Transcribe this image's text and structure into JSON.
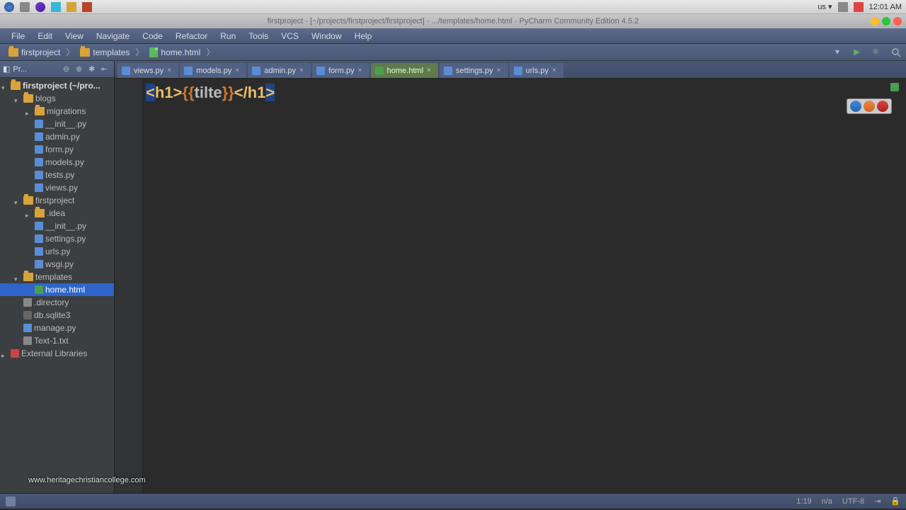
{
  "desktop": {
    "clock": "12:01 AM",
    "indicator": "us ▾"
  },
  "window": {
    "title": "firstproject - [~/projects/firstproject/firstproject] - .../templates/home.html - PyCharm Community Edition 4.5.2"
  },
  "menu": [
    "File",
    "Edit",
    "View",
    "Navigate",
    "Code",
    "Refactor",
    "Run",
    "Tools",
    "VCS",
    "Window",
    "Help"
  ],
  "breadcrumb": [
    {
      "icon": "folder",
      "label": "firstproject"
    },
    {
      "icon": "folder",
      "label": "templates"
    },
    {
      "icon": "html",
      "label": "home.html"
    }
  ],
  "project_panel": {
    "title": "Pr..."
  },
  "tree": {
    "root": {
      "label": "firstproject (~/pro...",
      "icon": "folder"
    },
    "items": [
      {
        "depth": 1,
        "arrow": "down",
        "icon": "folder",
        "label": "blogs"
      },
      {
        "depth": 2,
        "arrow": "right",
        "icon": "folder",
        "label": "migrations"
      },
      {
        "depth": 2,
        "arrow": "none",
        "icon": "py",
        "label": "__init__.py"
      },
      {
        "depth": 2,
        "arrow": "none",
        "icon": "py",
        "label": "admin.py"
      },
      {
        "depth": 2,
        "arrow": "none",
        "icon": "py",
        "label": "form.py"
      },
      {
        "depth": 2,
        "arrow": "none",
        "icon": "py",
        "label": "models.py"
      },
      {
        "depth": 2,
        "arrow": "none",
        "icon": "py",
        "label": "tests.py"
      },
      {
        "depth": 2,
        "arrow": "none",
        "icon": "py",
        "label": "views.py"
      },
      {
        "depth": 1,
        "arrow": "down",
        "icon": "folder",
        "label": "firstproject"
      },
      {
        "depth": 2,
        "arrow": "right",
        "icon": "folder",
        "label": ".idea"
      },
      {
        "depth": 2,
        "arrow": "none",
        "icon": "py",
        "label": "__init__.py"
      },
      {
        "depth": 2,
        "arrow": "none",
        "icon": "py",
        "label": "settings.py"
      },
      {
        "depth": 2,
        "arrow": "none",
        "icon": "py",
        "label": "urls.py"
      },
      {
        "depth": 2,
        "arrow": "none",
        "icon": "py",
        "label": "wsgi.py"
      },
      {
        "depth": 1,
        "arrow": "down",
        "icon": "folder",
        "label": "templates"
      },
      {
        "depth": 2,
        "arrow": "none",
        "icon": "html",
        "label": "home.html",
        "selected": true
      },
      {
        "depth": 1,
        "arrow": "none",
        "icon": "txt",
        "label": ".directory"
      },
      {
        "depth": 1,
        "arrow": "none",
        "icon": "db",
        "label": "db.sqlite3"
      },
      {
        "depth": 1,
        "arrow": "none",
        "icon": "py",
        "label": "manage.py"
      },
      {
        "depth": 1,
        "arrow": "none",
        "icon": "txt",
        "label": "Text-1.txt"
      }
    ],
    "external": "External Libraries"
  },
  "tabs": [
    {
      "icon": "py",
      "label": "views.py",
      "active": false
    },
    {
      "icon": "py",
      "label": "models.py",
      "active": false
    },
    {
      "icon": "py",
      "label": "admin.py",
      "active": false
    },
    {
      "icon": "py",
      "label": "form.py",
      "active": false
    },
    {
      "icon": "html",
      "label": "home.html",
      "active": true
    },
    {
      "icon": "py",
      "label": "settings.py",
      "active": false
    },
    {
      "icon": "py",
      "label": "urls.py",
      "active": false
    }
  ],
  "editor": {
    "code_open_bracket": "<",
    "code_tag_open": "h1>",
    "code_braces_open": "{{",
    "code_var": "tilte",
    "code_braces_close": "}}",
    "code_tag_close_open": "<",
    "code_tag_close": "/h1",
    "code_close_bracket": ">"
  },
  "status": {
    "position": "1:19",
    "eol": "n/a",
    "encoding": "UTF-8",
    "indent": "⇥",
    "lock": "🔒"
  },
  "watermark": "www.heritagechristiancollege.com"
}
